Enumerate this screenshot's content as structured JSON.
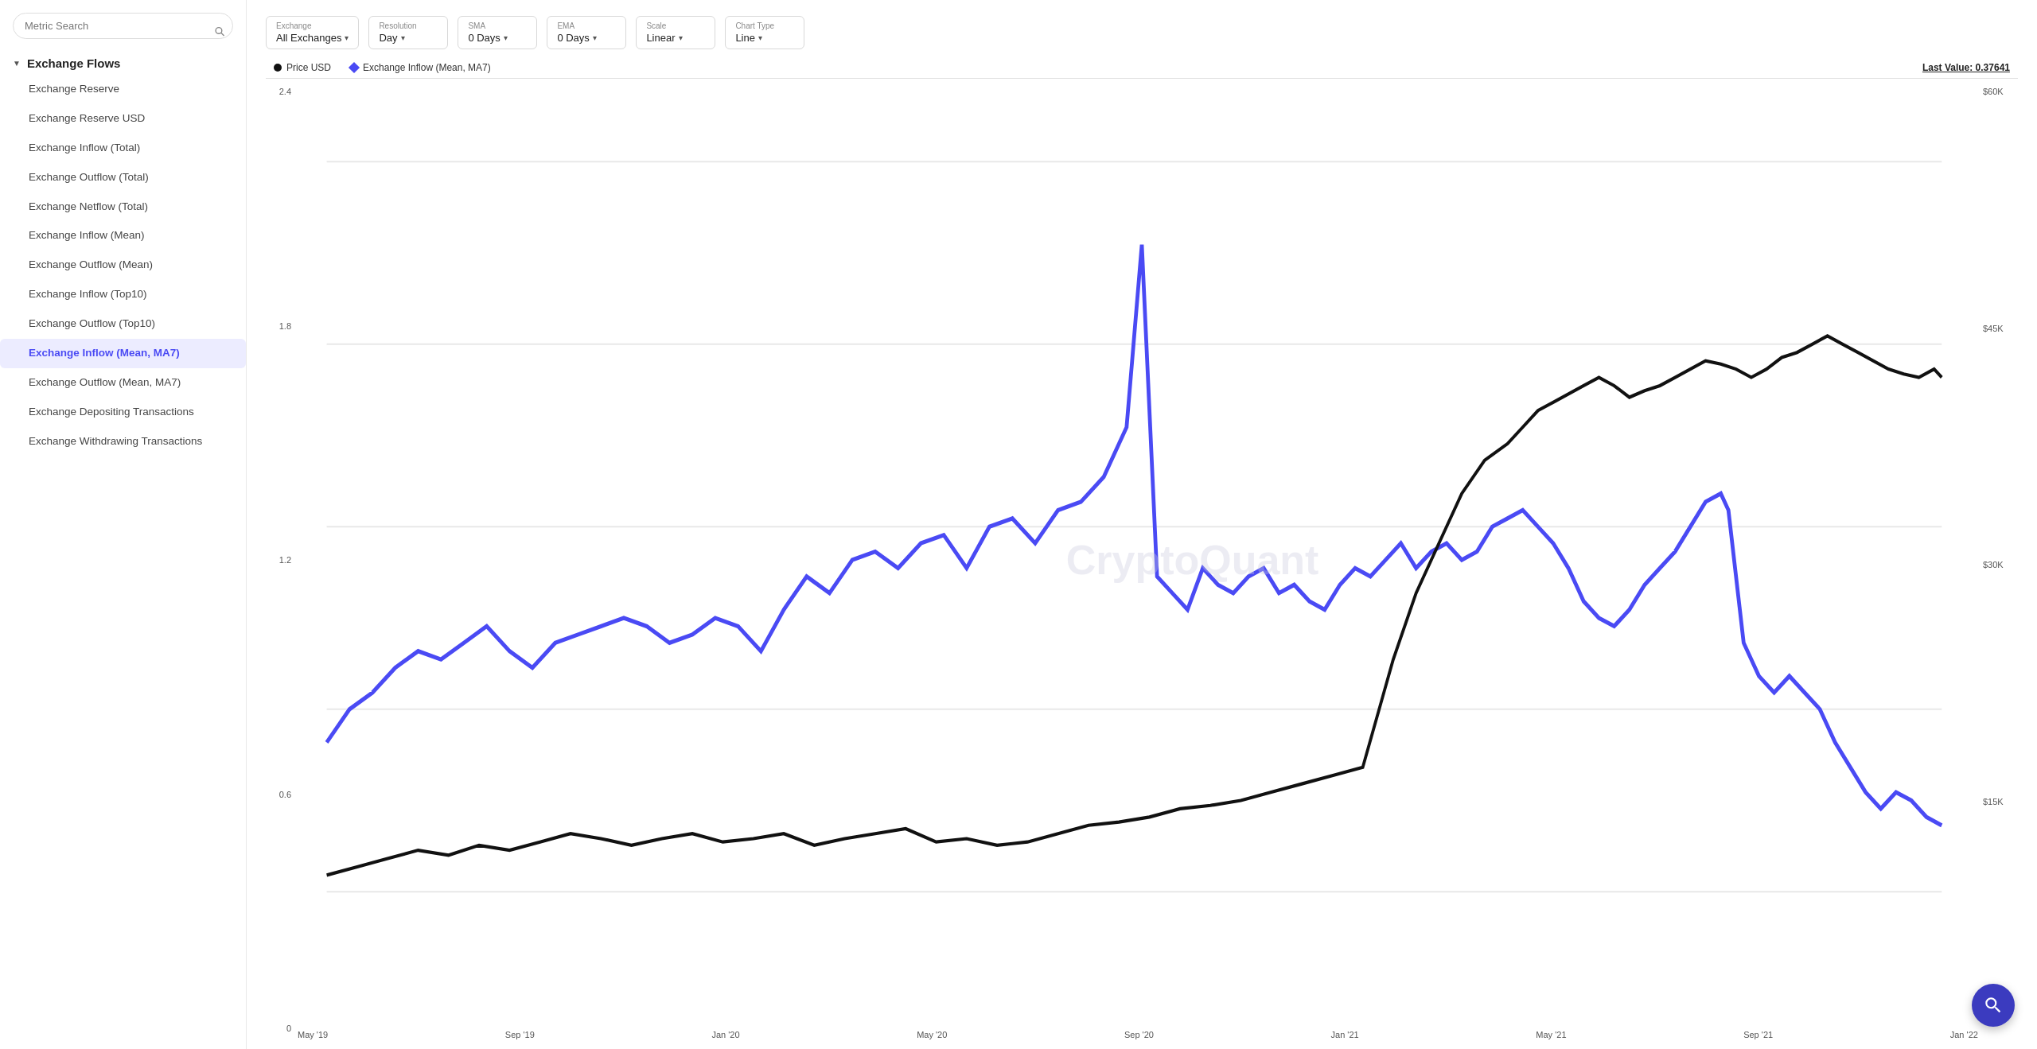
{
  "sidebar": {
    "search_placeholder": "Metric Search",
    "section_label": "Exchange Flows",
    "items": [
      {
        "label": "Exchange Reserve",
        "active": false
      },
      {
        "label": "Exchange Reserve USD",
        "active": false
      },
      {
        "label": "Exchange Inflow (Total)",
        "active": false
      },
      {
        "label": "Exchange Outflow (Total)",
        "active": false
      },
      {
        "label": "Exchange Netflow (Total)",
        "active": false
      },
      {
        "label": "Exchange Inflow (Mean)",
        "active": false
      },
      {
        "label": "Exchange Outflow (Mean)",
        "active": false
      },
      {
        "label": "Exchange Inflow (Top10)",
        "active": false
      },
      {
        "label": "Exchange Outflow (Top10)",
        "active": false
      },
      {
        "label": "Exchange Inflow (Mean, MA7)",
        "active": true
      },
      {
        "label": "Exchange Outflow (Mean, MA7)",
        "active": false
      },
      {
        "label": "Exchange Depositing Transactions",
        "active": false
      },
      {
        "label": "Exchange Withdrawing Transactions",
        "active": false
      }
    ]
  },
  "controls": {
    "exchange": {
      "label": "Exchange",
      "value": "All Exchanges"
    },
    "resolution": {
      "label": "Resolution",
      "value": "Day"
    },
    "sma": {
      "label": "SMA",
      "value": "0 Days"
    },
    "ema": {
      "label": "EMA",
      "value": "0 Days"
    },
    "scale": {
      "label": "Scale",
      "value": "Linear"
    },
    "chart_type": {
      "label": "Chart Type",
      "value": "Line"
    }
  },
  "legend": {
    "price_label": "Price USD",
    "inflow_label": "Exchange Inflow (Mean, MA7)",
    "last_value_label": "Last Value: 0.37641"
  },
  "chart": {
    "y_labels_left": [
      "2.4",
      "1.8",
      "1.2",
      "0.6",
      "0"
    ],
    "y_labels_right": [
      "$60K",
      "$45K",
      "$30K",
      "$15K",
      ""
    ],
    "x_labels": [
      "May '19",
      "Sep '19",
      "Jan '20",
      "May '20",
      "Sep '20",
      "Jan '21",
      "May '21",
      "Sep '21",
      "Jan '22"
    ],
    "watermark": "CryptoQuant"
  },
  "fab": {
    "icon": "search-icon"
  }
}
